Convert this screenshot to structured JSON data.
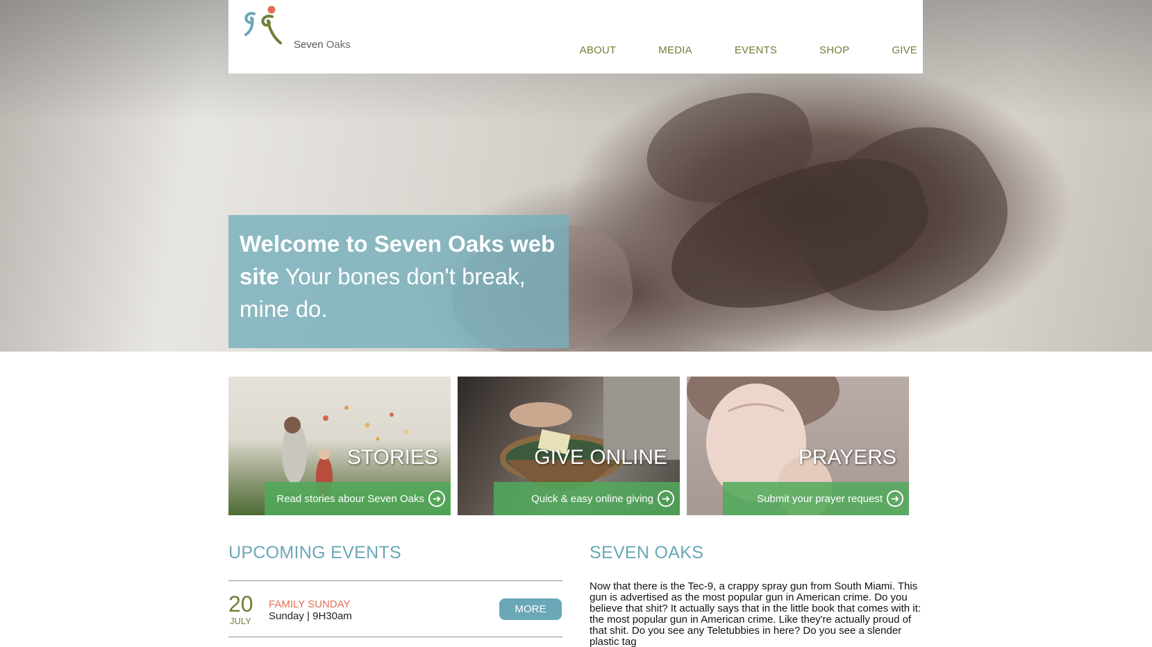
{
  "brand": {
    "name_part1": "Seven",
    "name_part2": " Oaks",
    "colors": {
      "teal": "#6aa7b7",
      "olive": "#6d7f36",
      "coral": "#e06d54",
      "green": "#50aa5a"
    }
  },
  "nav": {
    "items": [
      "ABOUT",
      "MEDIA",
      "EVENTS",
      "SHOP",
      "GIVE"
    ]
  },
  "hero": {
    "welcome_bold": "Welcome to Seven Oaks web site",
    "welcome_rest": " Your bones don't break, mine do."
  },
  "tiles": [
    {
      "title": "STORIES",
      "link": "Read stories abour Seven Oaks",
      "icon": "arrow-circle-right-icon"
    },
    {
      "title": "GIVE ONLINE",
      "link": "Quick & easy online giving",
      "icon": "arrow-circle-right-icon"
    },
    {
      "title": "PRAYERS",
      "link": "Submit your prayer request",
      "icon": "arrow-circle-right-icon"
    }
  ],
  "events": {
    "heading": "UPCOMING EVENTS",
    "items": [
      {
        "day": "20",
        "month": "JULY",
        "name": "FAMILY SUNDAY",
        "time": "Sunday | 9H30am",
        "button": "MORE"
      }
    ]
  },
  "about": {
    "heading": "SEVEN OAKS",
    "body": "Now that there is the Tec-9, a crappy spray gun from South Miami. This gun is advertised as the most popular gun in American crime. Do you believe that shit? It actually says that in the little book that comes with it: the most popular gun in American crime. Like they're actually proud of that shit. Do you see any Teletubbies in here? Do you see a slender plastic tag"
  }
}
